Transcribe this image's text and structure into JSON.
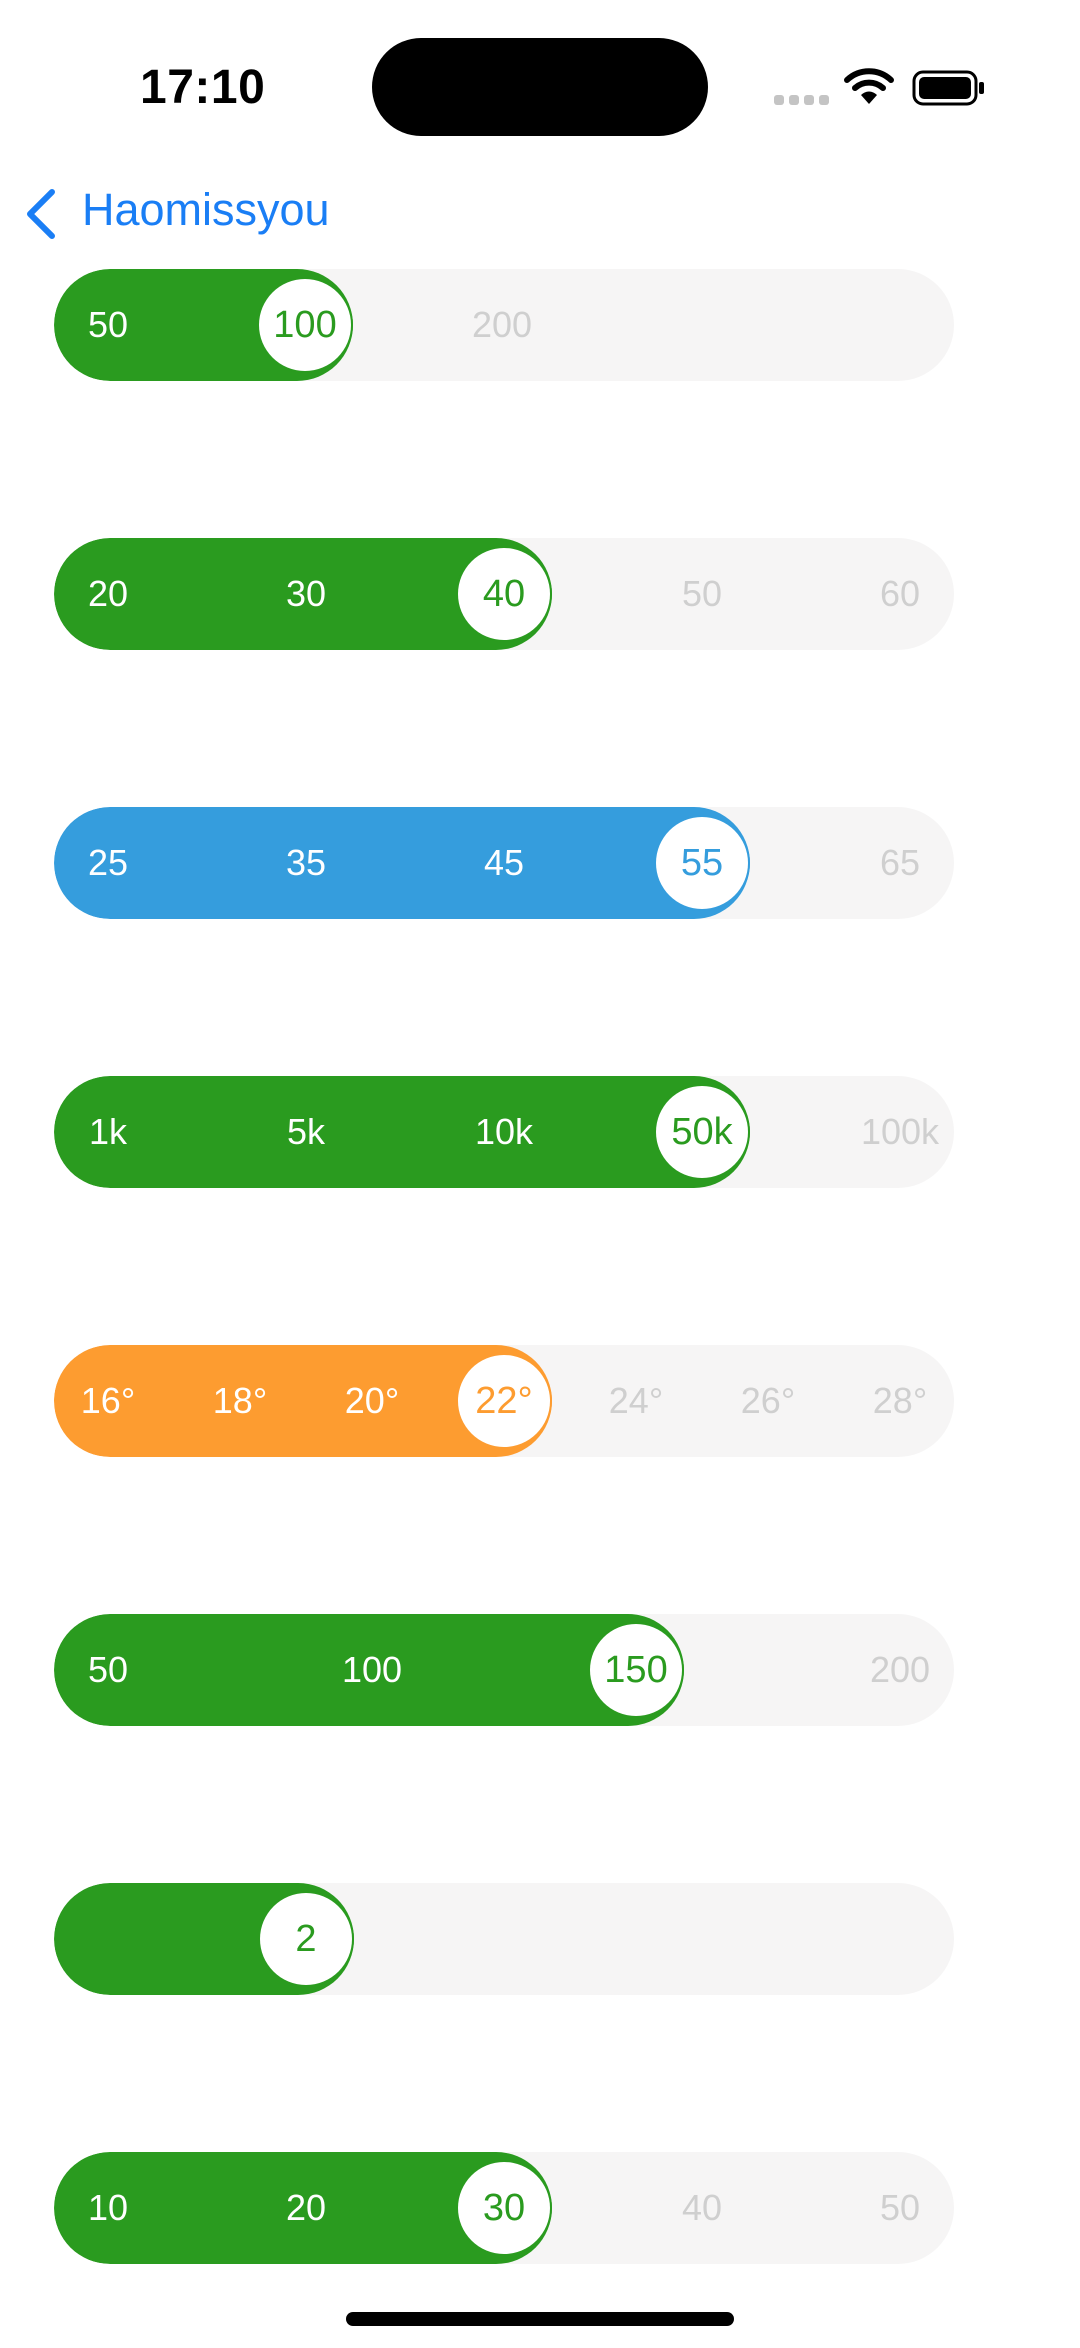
{
  "status": {
    "time": "17:10"
  },
  "nav": {
    "back_label": "Haomissyou"
  },
  "colors": {
    "green": "#2a9b1f",
    "blue": "#359ddd",
    "orange": "#fd9c30",
    "track": "#f6f5f5",
    "inactive_text": "#cfcfcf",
    "link": "#1a7ef5"
  },
  "sliders": [
    {
      "color": "green",
      "ticks": [
        "50",
        "100",
        "200"
      ],
      "selected": 1
    },
    {
      "color": "green",
      "ticks": [
        "20",
        "30",
        "40",
        "50",
        "60"
      ],
      "selected": 2
    },
    {
      "color": "blue",
      "ticks": [
        "25",
        "35",
        "45",
        "55",
        "65"
      ],
      "selected": 3
    },
    {
      "color": "green",
      "ticks": [
        "1k",
        "5k",
        "10k",
        "50k",
        "100k"
      ],
      "selected": 3
    },
    {
      "color": "orange",
      "ticks": [
        "16°",
        "18°",
        "20°",
        "22°",
        "24°",
        "26°",
        "28°"
      ],
      "selected": 3
    },
    {
      "color": "green",
      "ticks": [
        "50",
        "100",
        "150",
        "200"
      ],
      "selected": 2
    },
    {
      "color": "green",
      "ticks": [
        "2"
      ],
      "selected": 0
    },
    {
      "color": "green",
      "ticks": [
        "10",
        "20",
        "30",
        "40",
        "50"
      ],
      "selected": 2
    }
  ]
}
